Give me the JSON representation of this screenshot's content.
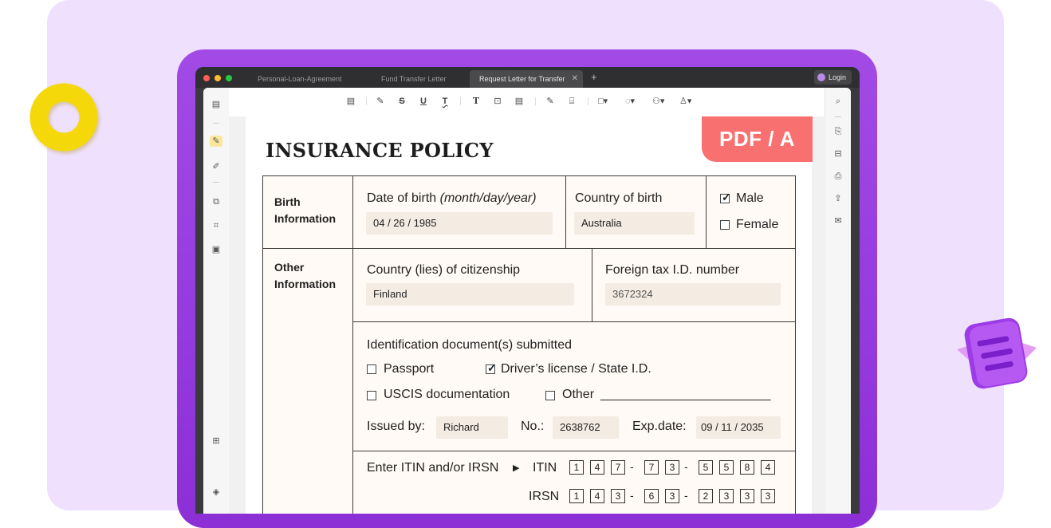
{
  "window": {
    "tabs": [
      {
        "label": "Personal-Loan-Agreement"
      },
      {
        "label": "Fund Transfer Letter"
      },
      {
        "label": "Request Letter for Transfer"
      }
    ],
    "close_glyph": "✕",
    "new_tab": "+",
    "login_label": "Login"
  },
  "document": {
    "title": "INSURANCE POLICY",
    "badge": "PDF / A"
  },
  "form": {
    "birth": {
      "section_label": "Birth Information",
      "dob_label": "Date of birth",
      "dob_hint": "(month/day/year)",
      "dob_value": "04 / 26 / 1985",
      "country_label": "Country of birth",
      "country_value": "Australia",
      "male_label": "Male",
      "female_label": "Female"
    },
    "other": {
      "section_label": "Other Information",
      "citizenship_label": "Country (lies) of citizenship",
      "citizenship_value": "Finland",
      "taxid_label": "Foreign tax I.D. number",
      "taxid_value": "3672324",
      "id_docs_label": "Identification document(s) submitted",
      "passport_label": "Passport",
      "drivers_label": "Driver’s license / State I.D.",
      "uscis_label": "USCIS documentation",
      "other_label": "Other",
      "other_line": "________________________",
      "issued_label": "Issued by:",
      "issued_value": "Richard",
      "no_label": "No.:",
      "no_value": "2638762",
      "exp_label": "Exp.date:",
      "exp_value": "09 / 11  / 2035",
      "itin_prompt": "Enter ITIN and/or IRSN",
      "arrow": "▶",
      "itin_label": "ITIN",
      "itin_digits": [
        "1",
        "4",
        "7",
        "7",
        "3",
        "5",
        "5",
        "8",
        "4"
      ],
      "irsn_label": "IRSN",
      "irsn_digits": [
        "1",
        "4",
        "3",
        "6",
        "3",
        "2",
        "3",
        "3",
        "3"
      ],
      "dash": "-"
    }
  },
  "checks": {
    "mark": "✓"
  },
  "colors": {
    "device": "#9b3fe0",
    "badge": "#f87070",
    "background_panel": "#efe0fd",
    "ring": "#f5d80a"
  }
}
